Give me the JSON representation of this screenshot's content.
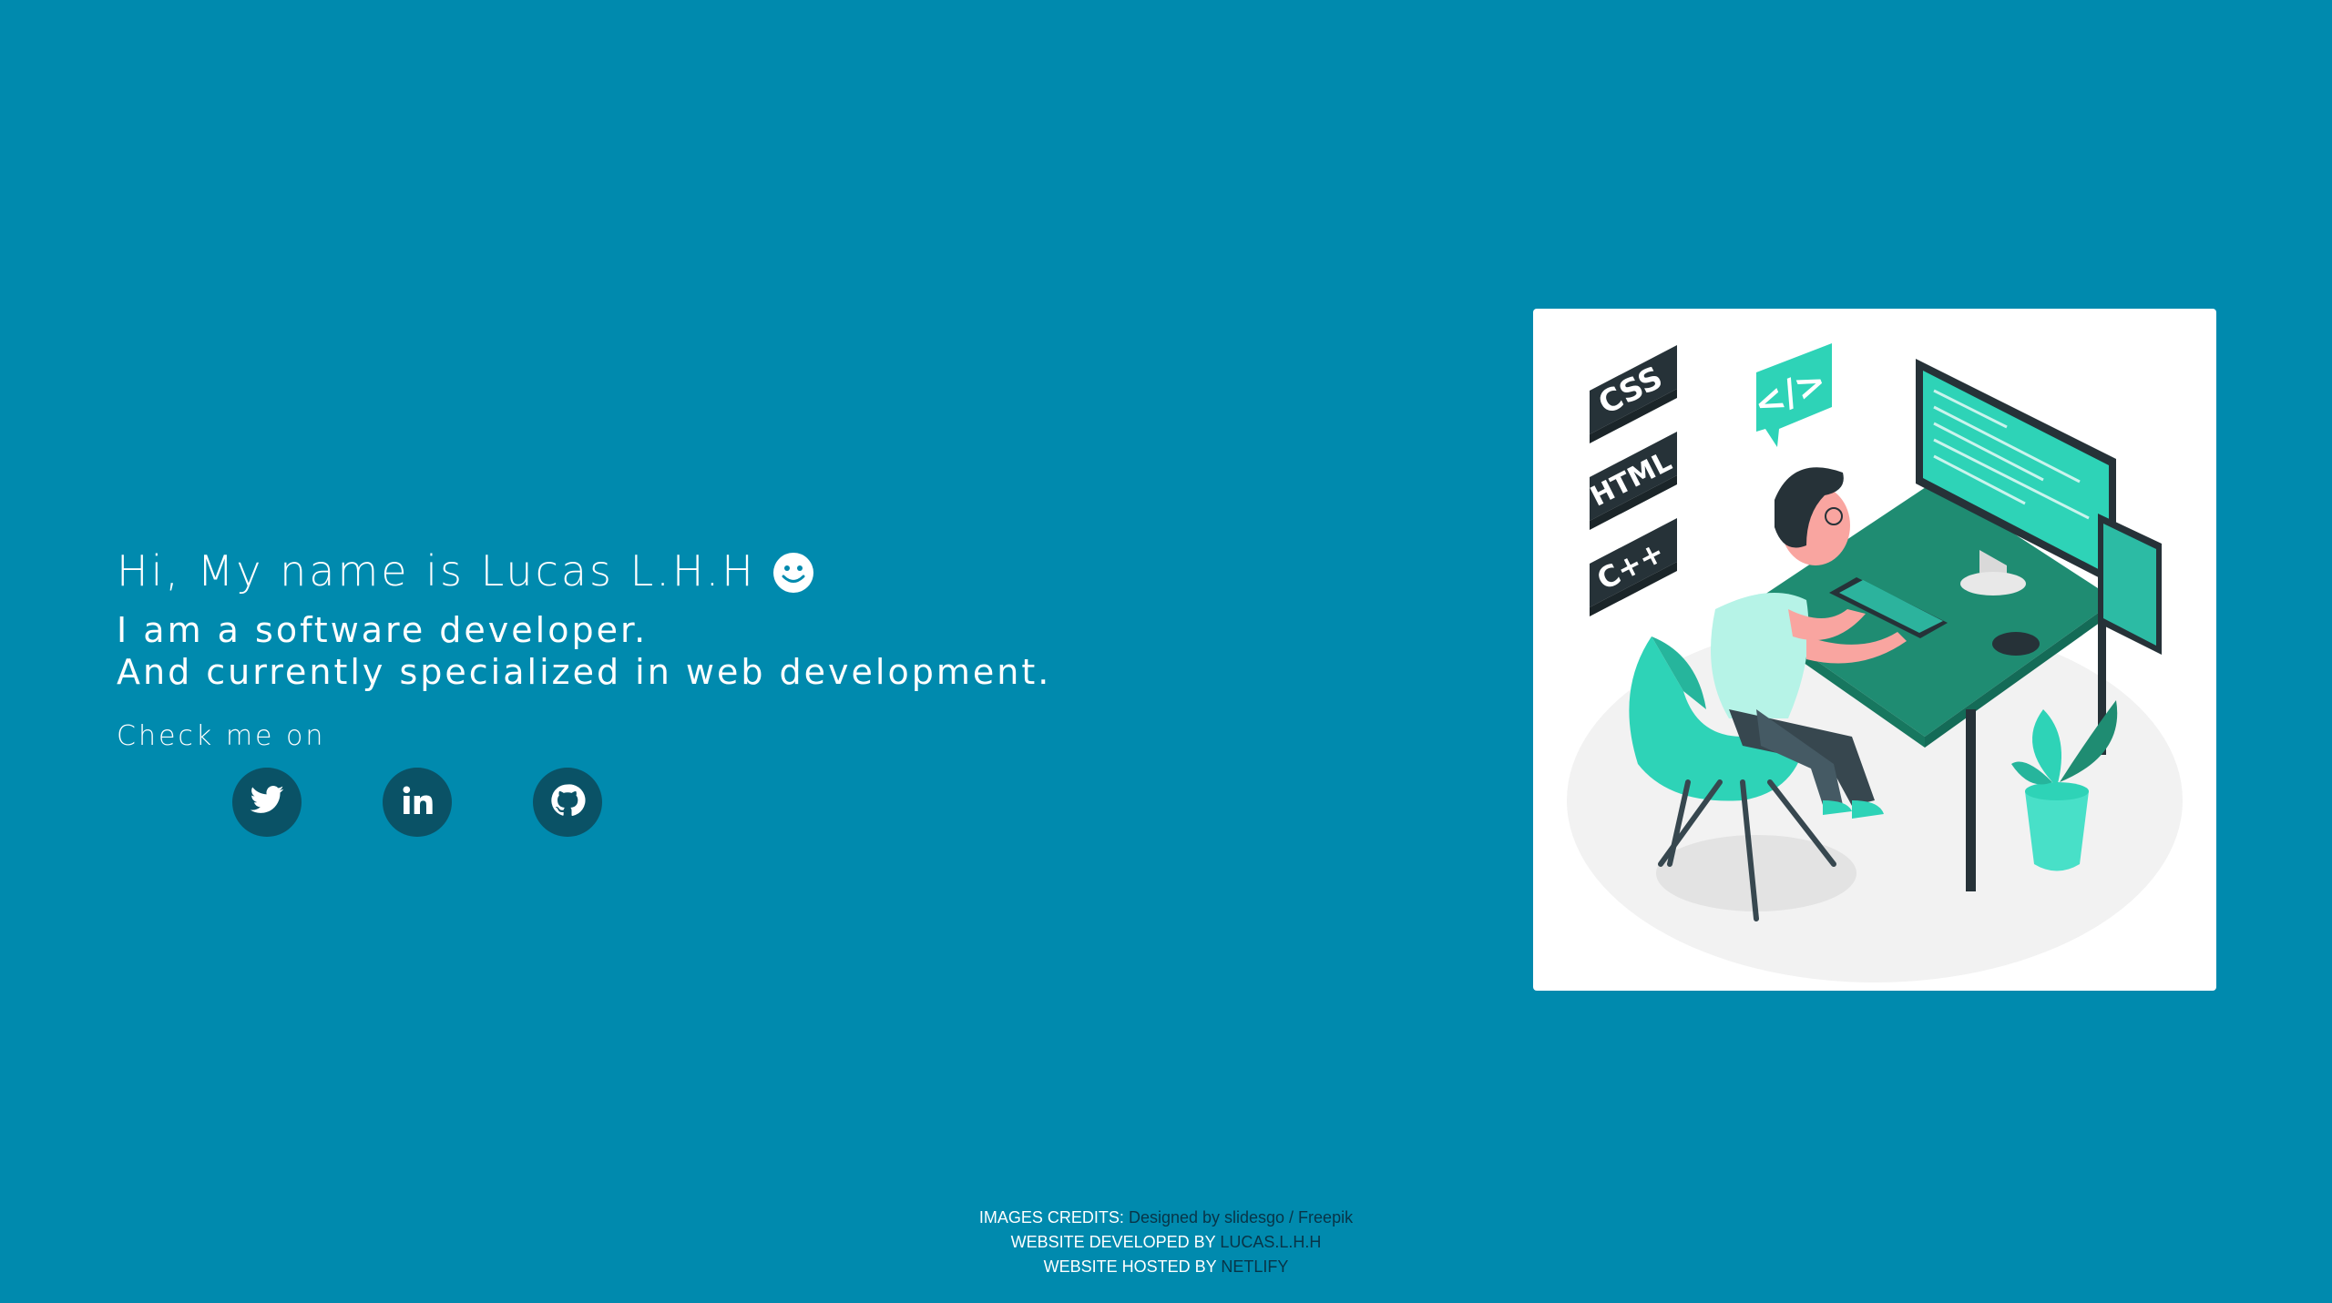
{
  "intro": {
    "greeting": "Hi, My name is Lucas L.H.H",
    "line1": "I am a software developer.",
    "line2": "And currently specialized in web development.",
    "check": "Check me on"
  },
  "socials": [
    {
      "name": "twitter",
      "icon": "twitter-icon"
    },
    {
      "name": "linkedin",
      "icon": "linkedin-icon"
    },
    {
      "name": "github",
      "icon": "github-icon"
    }
  ],
  "illustration": {
    "tags": [
      "CSS",
      "HTML",
      "C++"
    ],
    "code_bubble": "</>"
  },
  "footer": {
    "credits_label": "IMAGES CREDITS:",
    "credits_value": "Designed by slidesgo / Freepik",
    "developed_label": "WEBSITE DEVELOPED BY",
    "developed_value": "LUCAS.L.H.H",
    "hosted_label": "WEBSITE HOSTED BY",
    "hosted_value": "NETLIFY"
  },
  "colors": {
    "background": "#008aae",
    "social_circle": "#0a5266",
    "accent": "#2ed3b7",
    "footer_link": "#083447"
  }
}
